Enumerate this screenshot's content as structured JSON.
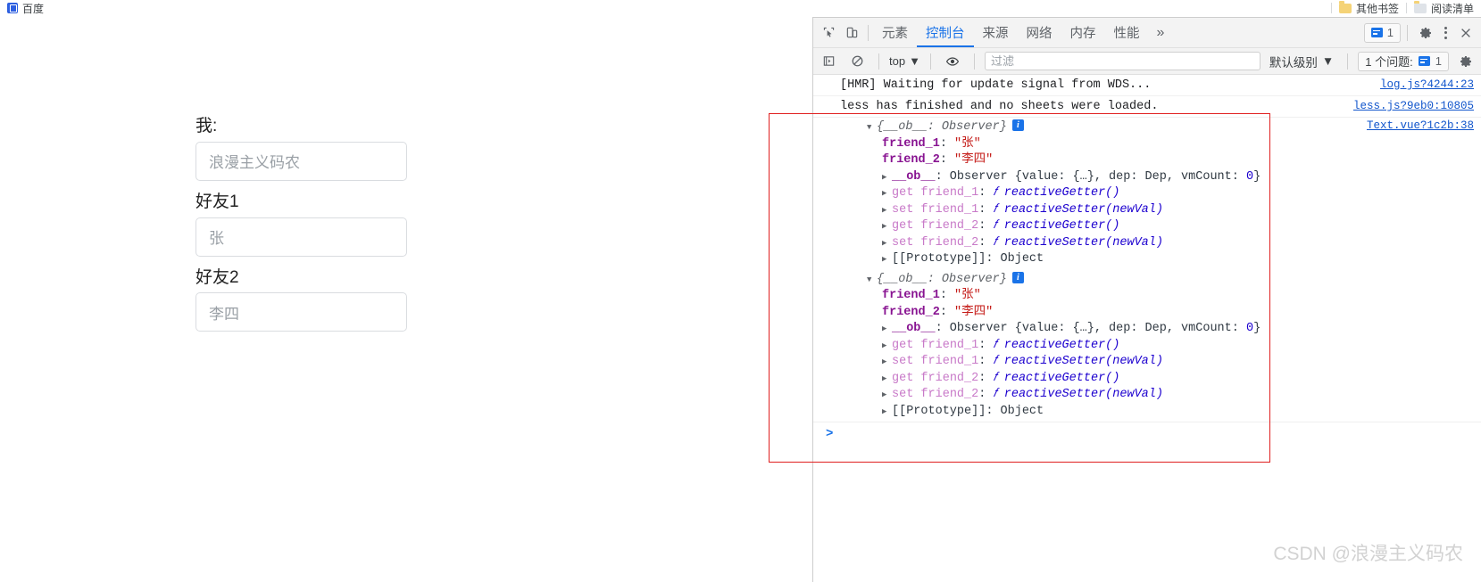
{
  "browser": {
    "bookmarks": [
      {
        "label": "百度",
        "icon": "baidu-icon"
      }
    ],
    "other_bookmarks_label": "其他书签",
    "reading_list_label": "阅读清单"
  },
  "app": {
    "fields": [
      {
        "label": "我:",
        "value": "浪漫主义码农"
      },
      {
        "label": "好友1",
        "value": "张"
      },
      {
        "label": "好友2",
        "value": "李四"
      }
    ]
  },
  "devtools": {
    "toolbar": {
      "inspect_icon": "inspect-element-icon",
      "device_icon": "device-toolbar-icon",
      "tabs": [
        {
          "label": "元素",
          "active": false
        },
        {
          "label": "控制台",
          "active": true
        },
        {
          "label": "来源",
          "active": false
        },
        {
          "label": "网络",
          "active": false
        },
        {
          "label": "内存",
          "active": false
        },
        {
          "label": "性能",
          "active": false
        }
      ],
      "more_tabs_label": "»",
      "message_count": "1",
      "settings_icon": "gear-icon",
      "more_options_icon": "kebab-menu-icon",
      "close_icon": "close-icon"
    },
    "console_toolbar": {
      "sidebar_icon": "console-sidebar-icon",
      "clear_icon": "clear-console-icon",
      "context_value": "top",
      "eye_icon": "live-expression-icon",
      "filter_placeholder": "过滤",
      "filter_value": "",
      "level_value": "默认级别",
      "issues_label": "1 个问题:",
      "issues_count": "1",
      "console_settings_icon": "gear-icon"
    },
    "console": {
      "messages": [
        {
          "text": "[HMR] Waiting for update signal from WDS...",
          "source": "log.js?4244:23"
        },
        {
          "text": "less has finished and no sheets were loaded.",
          "source": "less.js?9eb0:10805"
        }
      ],
      "objects": [
        {
          "header": "{__ob__: Observer}",
          "source": "Text.vue?1c2b:38",
          "props": [
            {
              "key": "friend_1",
              "value": "\"张\""
            },
            {
              "key": "friend_2",
              "value": "\"李四\""
            }
          ],
          "observer": {
            "key": "__ob__",
            "text": ": Observer {value: {…}, dep: Dep, vmCount: ",
            "num": "0",
            "tail": "}"
          },
          "accessors": [
            {
              "kind": "get",
              "name": "friend_1",
              "fn": "reactiveGetter()"
            },
            {
              "kind": "set",
              "name": "friend_1",
              "fn": "reactiveSetter(newVal)"
            },
            {
              "kind": "get",
              "name": "friend_2",
              "fn": "reactiveGetter()"
            },
            {
              "kind": "set",
              "name": "friend_2",
              "fn": "reactiveSetter(newVal)"
            }
          ],
          "prototype": "[[Prototype]]: Object"
        },
        {
          "header": "{__ob__: Observer}",
          "source": "",
          "props": [
            {
              "key": "friend_1",
              "value": "\"张\""
            },
            {
              "key": "friend_2",
              "value": "\"李四\""
            }
          ],
          "observer": {
            "key": "__ob__",
            "text": ": Observer {value: {…}, dep: Dep, vmCount: ",
            "num": "0",
            "tail": "}"
          },
          "accessors": [
            {
              "kind": "get",
              "name": "friend_1",
              "fn": "reactiveGetter()"
            },
            {
              "kind": "set",
              "name": "friend_1",
              "fn": "reactiveSetter(newVal)"
            },
            {
              "kind": "get",
              "name": "friend_2",
              "fn": "reactiveGetter()"
            },
            {
              "kind": "set",
              "name": "friend_2",
              "fn": "reactiveSetter(newVal)"
            }
          ],
          "prototype": "[[Prototype]]: Object"
        }
      ],
      "prompt_symbol": ">"
    }
  },
  "watermark": "CSDN @浪漫主义码农",
  "colors": {
    "accent": "#1a73e8",
    "annotation": "#e02020",
    "string": "#c41a16",
    "property": "#881391",
    "number": "#1c00cf",
    "link": "#1155cc"
  }
}
